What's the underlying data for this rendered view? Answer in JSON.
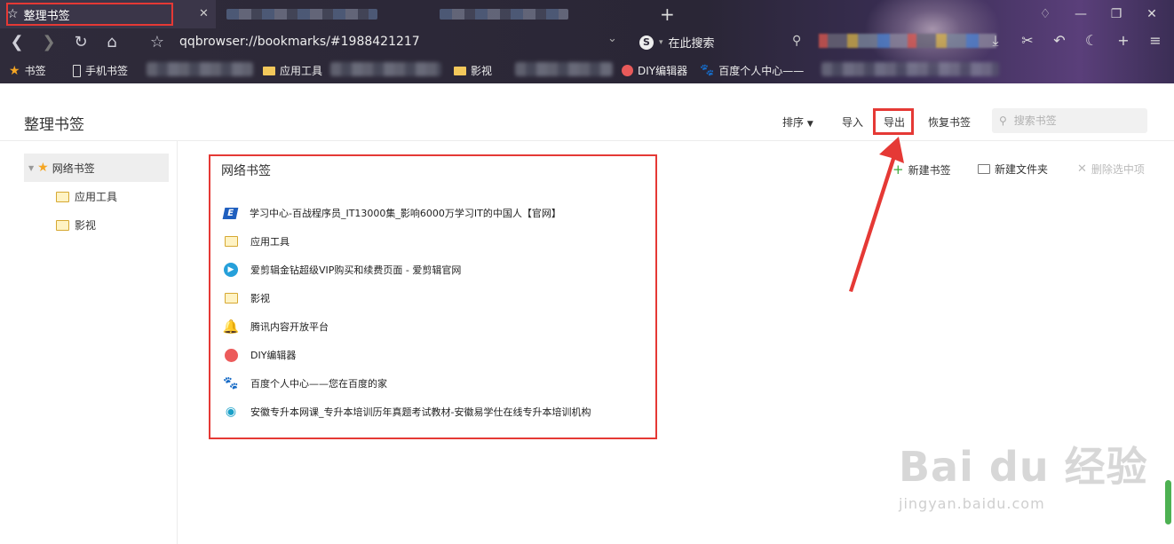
{
  "browser": {
    "active_tab_title": "整理书签",
    "url": "qqbrowser://bookmarks/#1988421217",
    "search_engine_label": "在此搜索",
    "new_tab_symbol": "+",
    "bookmarks_bar": {
      "label": "书签",
      "items": [
        "手机书签",
        "应用工具",
        "影视",
        "DIY编辑器",
        "百度个人中心——"
      ]
    }
  },
  "header": {
    "title": "整理书签",
    "sort_label": "排序",
    "import_label": "导入",
    "export_label": "导出",
    "restore_label": "恢复书签",
    "search_placeholder": "搜索书签"
  },
  "sidebar": {
    "root": "网络书签",
    "children": [
      "应用工具",
      "影视"
    ]
  },
  "main": {
    "title": "网络书签",
    "actions": {
      "new_bookmark": "新建书签",
      "new_folder": "新建文件夹",
      "delete_selected": "删除选中项"
    },
    "items": [
      {
        "label": "学习中心-百战程序员_IT13000集_影响6000万学习IT的中国人【官网】",
        "icon": "xuetang-icon"
      },
      {
        "label": "应用工具",
        "icon": "folder-icon"
      },
      {
        "label": "爱剪辑金钻超级VIP购买和续费页面 - 爱剪辑官网",
        "icon": "aijianji-icon"
      },
      {
        "label": "影视",
        "icon": "folder-icon"
      },
      {
        "label": "腾讯内容开放平台",
        "icon": "bell-icon"
      },
      {
        "label": "DIY编辑器",
        "icon": "red-circle-icon"
      },
      {
        "label": "百度个人中心——您在百度的家",
        "icon": "baidu-paw-icon"
      },
      {
        "label": "安徽专升本网课_专升本培训历年真题考试教材-安徽易学仕在线专升本培训机构",
        "icon": "location-pin-icon"
      }
    ]
  },
  "watermark": {
    "brand": "Bai du 经验",
    "url": "jingyan.baidu.com"
  },
  "colors": {
    "highlight_red": "#e53935",
    "chrome_dark": "#2f2b3a",
    "star_orange": "#f5a623",
    "plus_green": "#3aa83a"
  }
}
